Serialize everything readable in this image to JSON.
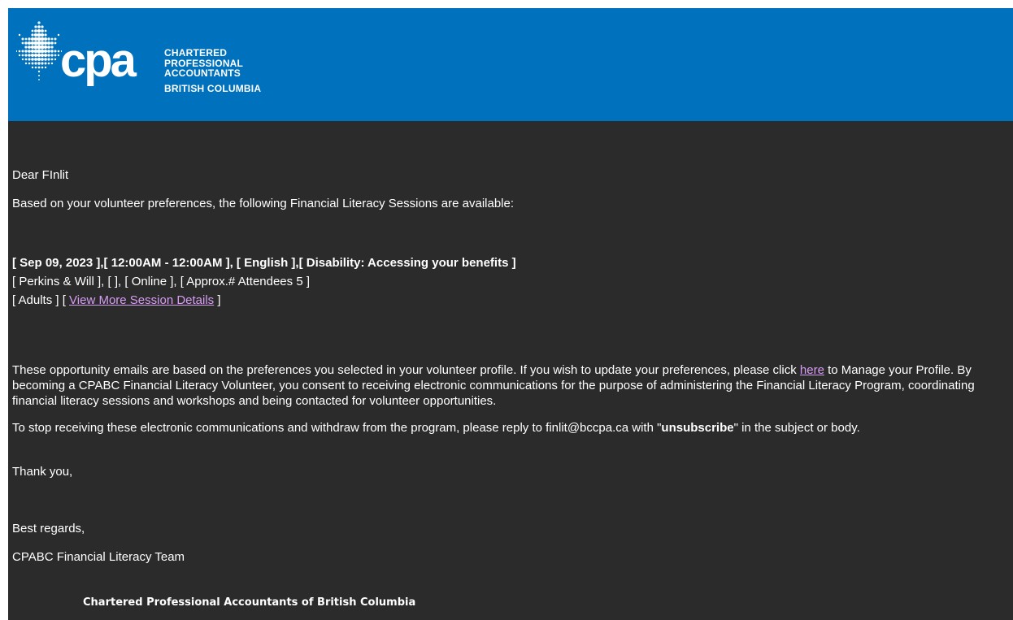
{
  "header": {
    "logo_mark": "cpa",
    "logo_lines": [
      "CHARTERED",
      "PROFESSIONAL",
      "ACCOUNTANTS"
    ],
    "logo_region": "BRITISH COLUMBIA",
    "brand_color": "#0071bc"
  },
  "email": {
    "greeting": "Dear FInlit",
    "intro": "Based on your volunteer preferences, the following Financial Literacy Sessions are available:",
    "session": {
      "title": "[ Sep 09, 2023 ],[ 12:00AM - 12:00AM ], [ English ],[ Disability: Accessing your benefits ]",
      "details": "[ Perkins & Will ], [ ], [ Online ], [ Approx.# Attendees 5 ]",
      "audience_prefix": "[ Adults ] [ ",
      "more_link": "View More Session Details",
      "audience_suffix": " ]"
    },
    "opportunity_part1": "These opportunity emails are based on the preferences you selected in your volunteer profile. If you wish to update your preferences, please click ",
    "here_link": "here",
    "opportunity_part2": " to Manage your Profile. By becoming a CPABC Financial Literacy Volunteer, you consent to receiving electronic communications for the purpose of administering the Financial Literacy Program, coordinating financial literacy sessions and workshops and being contacted for volunteer opportunities.",
    "unsub_part1": "To stop receiving these electronic communications and withdraw from the program, please reply to finlit@bccpa.ca with \"",
    "unsub_bold": "unsubscribe",
    "unsub_part2": "\" in the subject or body.",
    "thanks": "Thank you,",
    "regards": "Best regards,",
    "team": "CPABC Financial Literacy Team",
    "org": "Chartered Professional Accountants of British Columbia"
  }
}
